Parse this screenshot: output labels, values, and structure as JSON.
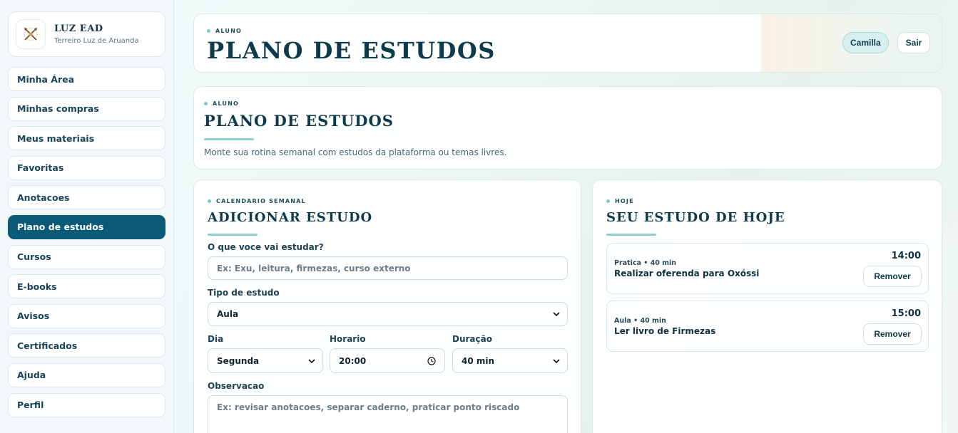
{
  "brand": {
    "title": "LUZ EAD",
    "subtitle": "Terreiro Luz de Aruanda",
    "logo_icon": "crossed-arrows-emblem-icon"
  },
  "sidebar": {
    "items": [
      {
        "label": "Minha Área",
        "active": false
      },
      {
        "label": "Minhas compras",
        "active": false
      },
      {
        "label": "Meus materiais",
        "active": false
      },
      {
        "label": "Favoritas",
        "active": false
      },
      {
        "label": "Anotacoes",
        "active": false
      },
      {
        "label": "Plano de estudos",
        "active": true
      },
      {
        "label": "Cursos",
        "active": false
      },
      {
        "label": "E-books",
        "active": false
      },
      {
        "label": "Avisos",
        "active": false
      },
      {
        "label": "Certificados",
        "active": false
      },
      {
        "label": "Ajuda",
        "active": false
      },
      {
        "label": "Perfil",
        "active": false
      }
    ]
  },
  "topbar": {
    "eyebrow": "ALUNO",
    "title": "PLANO DE ESTUDOS",
    "user_button": "Camilla",
    "logout_button": "Sair"
  },
  "hero": {
    "eyebrow": "ALUNO",
    "title": "PLANO DE ESTUDOS",
    "description": "Monte sua rotina semanal com estudos da plataforma ou temas livres."
  },
  "form": {
    "eyebrow": "CALENDARIO SEMANAL",
    "title": "ADICIONAR ESTUDO",
    "what_label": "O que voce vai estudar?",
    "what_placeholder": "Ex: Exu, leitura, firmezas, curso externo",
    "type_label": "Tipo de estudo",
    "type_value": "Aula",
    "day_label": "Dia",
    "day_value": "Segunda",
    "time_label": "Horario",
    "time_value": "20:00",
    "duration_label": "Duração",
    "duration_value": "40 min",
    "notes_label": "Observacao",
    "notes_placeholder": "Ex: revisar anotacoes, separar caderno, praticar ponto riscado"
  },
  "today": {
    "eyebrow": "HOJE",
    "title": "SEU ESTUDO DE HOJE",
    "tasks": [
      {
        "meta": "Pratica • 40 min",
        "title": "Realizar oferenda para Oxóssi",
        "time": "14:00",
        "remove": "Remover"
      },
      {
        "meta": "Aula • 40 min",
        "title": "Ler livro de Firmezas",
        "time": "15:00",
        "remove": "Remover"
      }
    ]
  },
  "colors": {
    "accent": "#0b5a78",
    "accent_soft": "#8fcdd4",
    "text": "#0f3a4a"
  }
}
